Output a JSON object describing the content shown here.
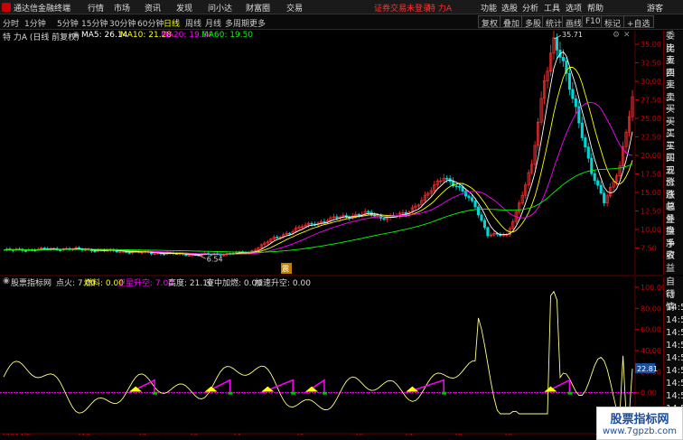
{
  "titlebar": {
    "app_name": "通达信金融终端",
    "menus": [
      "行情",
      "市场",
      "资讯",
      "发现",
      "问小达",
      "财富圈",
      "交易"
    ],
    "notice": "证券交易未登录",
    "stock_name": "特 力A",
    "right_menus": [
      "功能",
      "选股",
      "分析",
      "工具",
      "选项",
      "帮助"
    ],
    "guest": "游客"
  },
  "toolbar": {
    "periods": [
      "分时",
      "1分钟",
      "5分钟",
      "15分钟",
      "30分钟",
      "60分钟",
      "日线",
      "周线",
      "月线",
      "多周期",
      "更多"
    ],
    "active_period": "日线",
    "right_buttons": [
      "复权",
      "叠加",
      "多股",
      "统计",
      "画线",
      "F10",
      "标记",
      "+自选"
    ]
  },
  "info": {
    "title": "特 力A (日线 前复权)",
    "ma5": "MA5: 26.14",
    "ma10": "MA10: 21.28",
    "ma20": "MA20: 19.34",
    "ma60": "MA60: 19.50",
    "colors": {
      "ma5": "#ffffff",
      "ma10": "#ffff00",
      "ma20": "#ff00ff",
      "ma60": "#00ff00"
    }
  },
  "main_axis": {
    "labels": [
      "35.00",
      "32.50",
      "30.00",
      "27.50",
      "25.00",
      "22.50",
      "20.00",
      "17.50",
      "15.00",
      "12.50",
      "10.00",
      "7.50"
    ],
    "high_label": "35.71",
    "low_label": "6.54",
    "marker": "震"
  },
  "right_panel": [
    "委比",
    "卖五",
    "卖四",
    "卖三",
    "卖二",
    "卖一",
    "买一",
    "买二",
    "买三",
    "买四",
    "买五",
    "现价",
    "涨跌",
    "涨幅",
    "总量",
    "外盘",
    "换手",
    "净资",
    "收益"
  ],
  "indicator": {
    "name": "股票指标网",
    "fire": "点火: 7.00",
    "fuel": "燃料: 0.00",
    "satellite": "卫星升空: 7.00",
    "height": "高度: 21.16",
    "mid_air": "空中加燃: 0.00",
    "accel": "加速升空: 0.00",
    "axis_labels": [
      "100.00",
      "80.00",
      "60.00",
      "40.00",
      "20.00",
      "0.00",
      "-20.00"
    ],
    "current_value": "22.81"
  },
  "right_panel2": [
    "自动",
    "行情",
    "14:50",
    "14:50",
    "14:50",
    "14:50",
    "14:50",
    "14:50",
    "14:50",
    "14:50",
    "14:50",
    "14:50"
  ],
  "time_axis": [
    "2014年",
    "12",
    "2",
    "3",
    "4",
    "5",
    "6",
    "7",
    "8",
    "9",
    "1"
  ],
  "watermark": {
    "line1": "股票指标网",
    "line2": "www.7gpzb.com"
  }
}
